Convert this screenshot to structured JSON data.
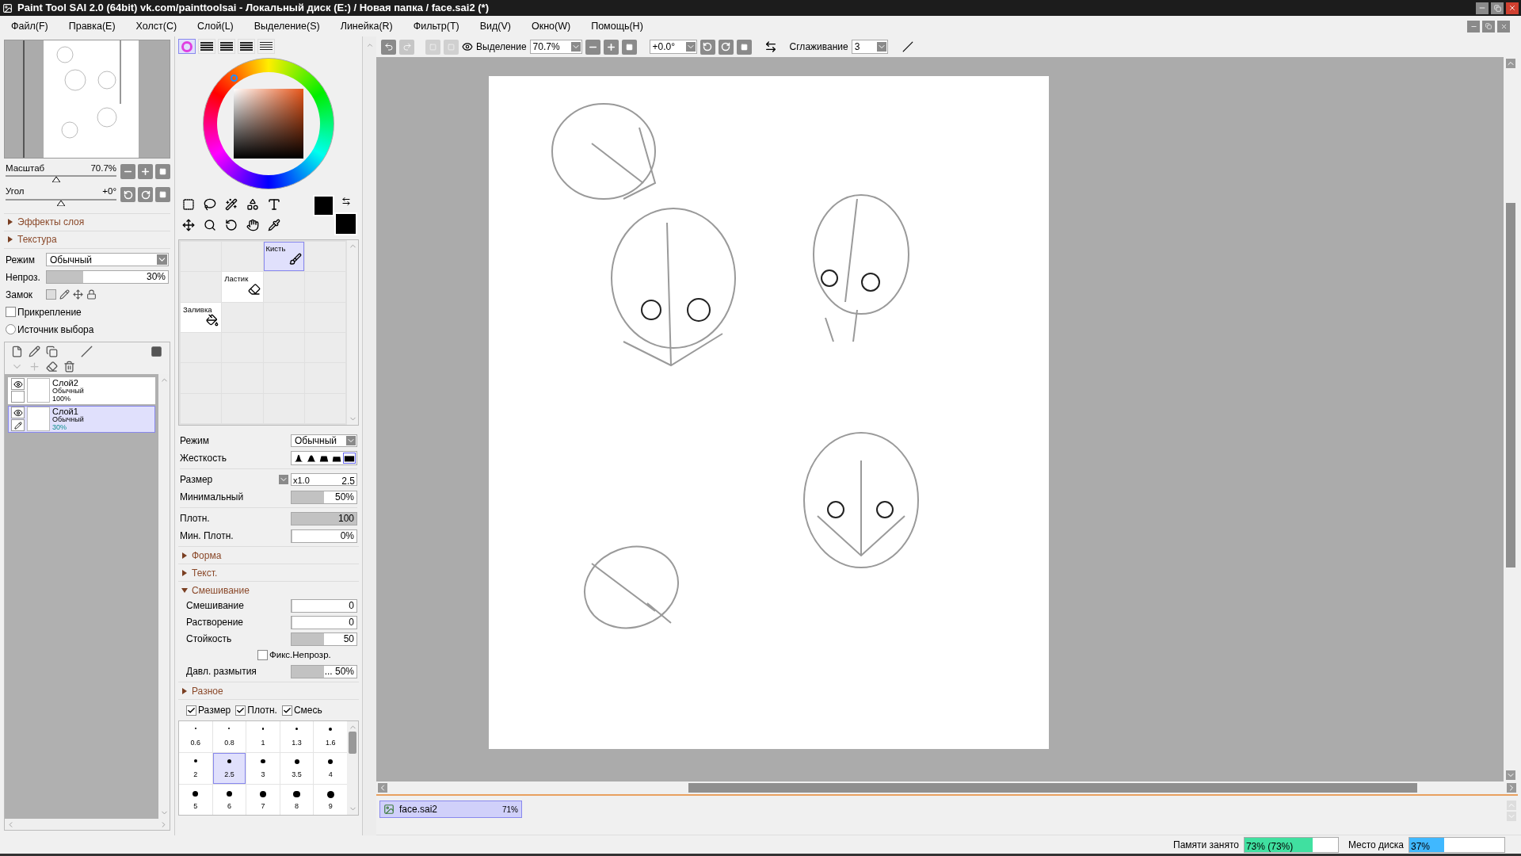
{
  "window": {
    "title": "Paint Tool SAI 2.0 (64bit) vk.com/painttoolsai - Локальный диск (E:) / Новая папка / face.sai2 (*)"
  },
  "menu": [
    "Файл(F)",
    "Правка(E)",
    "Холст(C)",
    "Слой(L)",
    "Выделение(S)",
    "Линейка(R)",
    "Фильтр(T)",
    "Вид(V)",
    "Окно(W)",
    "Помощь(H)"
  ],
  "toolbar": {
    "selection_label": "Выделение",
    "zoom": "70.7%",
    "angle": "+0.0°",
    "smoothing_label": "Сглаживание",
    "smoothing": "3"
  },
  "navigator": {
    "zoom": {
      "label": "Масштаб",
      "value": "70.7%",
      "level": 0.46
    },
    "angle": {
      "label": "Угол",
      "value": "+0°",
      "level": 0.5
    }
  },
  "layer_panel": {
    "sections": [
      {
        "label": "Эффекты слоя",
        "expanded": false
      },
      {
        "label": "Текстура",
        "expanded": false
      }
    ],
    "mode": {
      "label": "Режим",
      "value": "Обычный"
    },
    "opacity": {
      "label": "Непроз.",
      "value": "30%",
      "level": 0.3
    },
    "lock_label": "Замок",
    "options": [
      {
        "kind": "checkbox",
        "label": "Прикрепление",
        "checked": false
      },
      {
        "kind": "radio",
        "label": "Источник выбора",
        "checked": false
      }
    ],
    "layers": [
      {
        "name": "Слой2",
        "mode": "Обычный",
        "opacity": "100%",
        "visible": true,
        "editing": false,
        "selected": false
      },
      {
        "name": "Слой1",
        "mode": "Обычный",
        "opacity": "30%",
        "visible": true,
        "editing": true,
        "selected": true
      }
    ]
  },
  "color_tabs": [
    {
      "selected": true
    },
    {
      "selected": false
    },
    {
      "selected": false
    },
    {
      "selected": false
    },
    {
      "selected": false
    }
  ],
  "brushes": [
    {
      "kind": "brush",
      "label": "Кисть",
      "selected": true
    },
    {
      "kind": "eraser",
      "label": "Ластик",
      "selected": false
    },
    {
      "kind": "fill",
      "label": "Заливка",
      "selected": false
    }
  ],
  "brush_settings": {
    "mode": {
      "label": "Режим",
      "value": "Обычный"
    },
    "hardness": {
      "label": "Жесткость",
      "options": [
        {
          "selected": false
        },
        {
          "selected": false
        },
        {
          "selected": false
        },
        {
          "selected": false
        },
        {
          "selected": true
        }
      ]
    },
    "size": {
      "label": "Размер",
      "multiplier": "x1.0",
      "value": "2.5"
    },
    "min_size": {
      "label": "Минимальный",
      "value": "50%",
      "level": 0.5
    },
    "density": {
      "label": "Плотн.",
      "value": "100",
      "level": 1
    },
    "min_density": {
      "label": "Мин. Плотн.",
      "value": "0%",
      "level": 0
    },
    "sections": [
      {
        "label": "Форма",
        "expanded": false
      },
      {
        "label": "Текст.",
        "expanded": false
      },
      {
        "label": "Смешивание",
        "expanded": true,
        "fields": [
          {
            "kind": "slider",
            "label": "Смешивание",
            "value": "0",
            "level": 0
          },
          {
            "kind": "slider",
            "label": "Растворение",
            "value": "0",
            "level": 0
          },
          {
            "kind": "slider",
            "label": "Стойкость",
            "value": "50",
            "level": 0.5
          },
          {
            "kind": "checkbox",
            "label": "Фикс.Непрозр.",
            "checked": false
          },
          {
            "kind": "slider",
            "label": "Давл. размытия",
            "value": "... 50%",
            "level": 0.5
          }
        ]
      },
      {
        "label": "Разное",
        "expanded": false
      }
    ],
    "toggles": [
      {
        "label": "Размер",
        "checked": true
      },
      {
        "label": "Плотн.",
        "checked": true
      },
      {
        "label": "Смесь",
        "checked": true
      }
    ],
    "presets": [
      {
        "value": "0.6",
        "selected": false
      },
      {
        "value": "0.8",
        "selected": false
      },
      {
        "value": "1",
        "selected": false
      },
      {
        "value": "1.3",
        "selected": false
      },
      {
        "value": "1.6",
        "selected": false
      },
      {
        "value": "2",
        "selected": false
      },
      {
        "value": "2.5",
        "selected": true
      },
      {
        "value": "3",
        "selected": false
      },
      {
        "value": "3.5",
        "selected": false
      },
      {
        "value": "4",
        "selected": false
      },
      {
        "value": "5",
        "selected": false
      },
      {
        "value": "6",
        "selected": false
      },
      {
        "value": "7",
        "selected": false
      },
      {
        "value": "8",
        "selected": false
      },
      {
        "value": "9",
        "selected": false
      }
    ]
  },
  "document_tabs": [
    {
      "label": "face.sai2",
      "zoom": "71%",
      "selected": true
    }
  ],
  "status": {
    "memory": {
      "label": "Памяти занято",
      "value": "73% (73%)",
      "level": 0.73
    },
    "disk": {
      "label": "Место диска",
      "value": "37%",
      "level": 0.37
    }
  }
}
